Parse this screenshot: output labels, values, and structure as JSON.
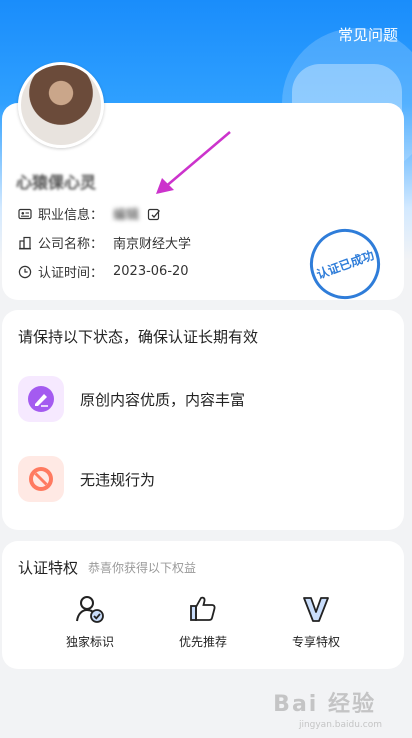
{
  "header": {
    "faq_label": "常见问题"
  },
  "profile": {
    "nickname": "心猿倮心灵",
    "job_label": "职业信息：",
    "job_value": "编辑",
    "company_label": "公司名称：",
    "company_value": "南京财经大学",
    "time_label": "认证时间：",
    "time_value": "2023-06-20",
    "stamp_text": "认证已成功"
  },
  "status": {
    "title": "请保持以下状态，确保认证长期有效",
    "items": [
      {
        "label": "原创内容优质，内容丰富",
        "icon": "pen-icon"
      },
      {
        "label": "无违规行为",
        "icon": "prohibited-icon"
      }
    ]
  },
  "privileges": {
    "title": "认证特权",
    "subtitle": "恭喜你获得以下权益",
    "items": [
      {
        "label": "独家标识",
        "icon": "user-badge-icon"
      },
      {
        "label": "优先推荐",
        "icon": "thumbs-up-icon"
      },
      {
        "label": "专享特权",
        "icon": "v-icon"
      }
    ]
  },
  "watermark": {
    "text": "Bai 经验",
    "sub": "jingyan.baidu.com"
  },
  "colors": {
    "accent": "#1a8dfb",
    "stamp": "#2f7dd9",
    "arrow": "#cc33cc"
  }
}
